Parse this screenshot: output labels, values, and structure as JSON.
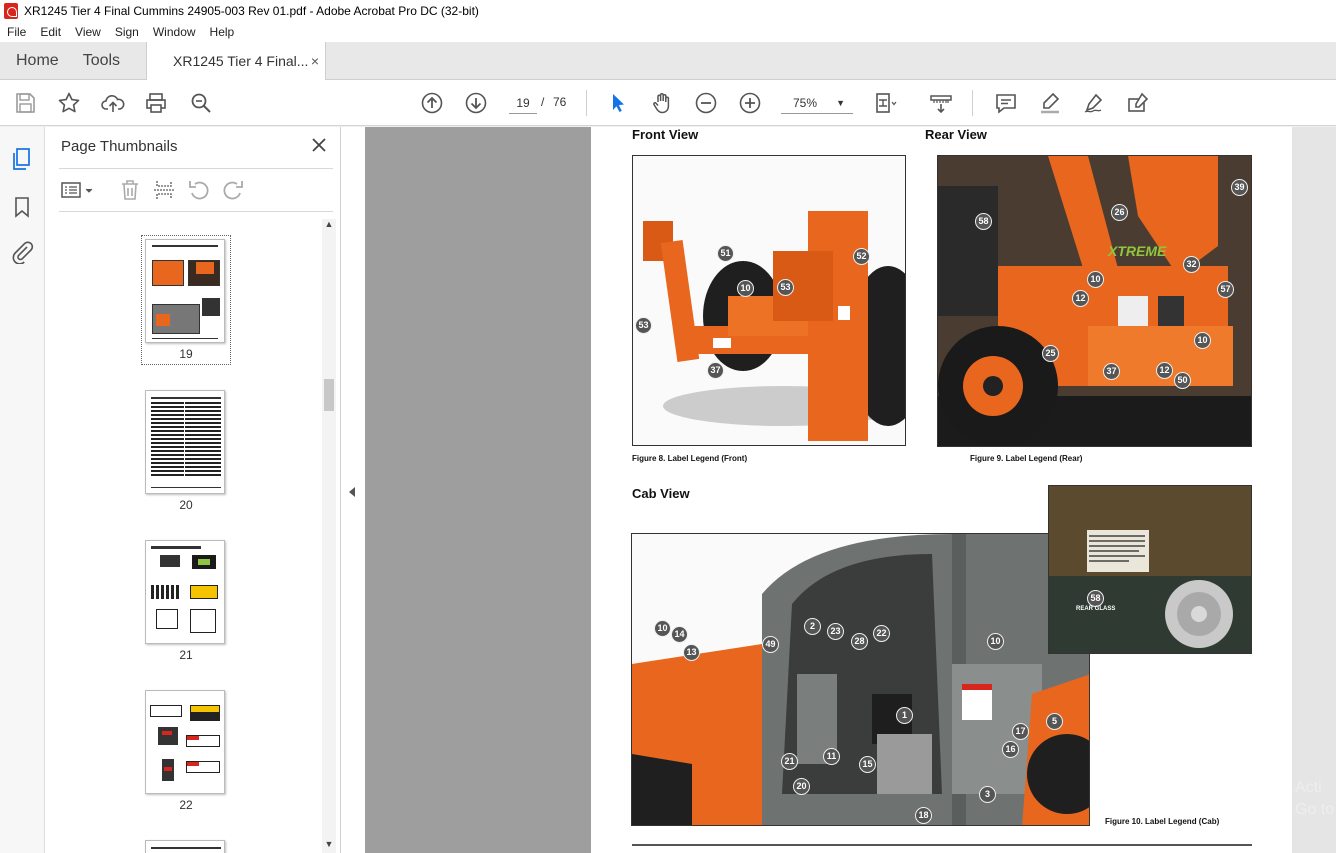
{
  "window": {
    "title": "XR1245 Tier 4 Final Cummins 24905-003 Rev 01.pdf - Adobe Acrobat Pro DC (32-bit)"
  },
  "menu": [
    "File",
    "Edit",
    "View",
    "Sign",
    "Window",
    "Help"
  ],
  "tabs": {
    "home": "Home",
    "tools": "Tools",
    "document": "XR1245 Tier 4 Final...",
    "close_symbol": "×"
  },
  "toolbar": {
    "current_page": "19",
    "page_separator": "/",
    "total_pages": "76",
    "zoom": "75%",
    "icons": [
      "save-icon",
      "bookmark-star-icon",
      "upload-icon",
      "print-icon",
      "zoom-search-icon",
      "page-up-icon",
      "page-down-icon",
      "select-cursor-icon",
      "hand-tool-icon",
      "zoom-out-icon",
      "zoom-in-icon",
      "page-fit-icon",
      "scroll-mode-icon",
      "comment-icon",
      "highlight-icon",
      "sign-icon",
      "fill-sign-icon"
    ]
  },
  "thumbnail_panel": {
    "title": "Page Thumbnails",
    "pages": [
      "19",
      "20",
      "21",
      "22"
    ]
  },
  "document": {
    "front_view_title": "Front View",
    "rear_view_title": "Rear View",
    "cab_view_title": "Cab View",
    "figure8_caption": "Figure 8. Label Legend (Front)",
    "figure9_caption": "Figure 9. Label Legend (Rear)",
    "figure10_caption": "Figure 10. Label Legend (Cab)",
    "rear_glass_label": "REAR GLASS",
    "front_callouts": [
      "51",
      "52",
      "10",
      "53",
      "53",
      "37"
    ],
    "rear_callouts": [
      "39",
      "26",
      "58",
      "32",
      "10",
      "57",
      "12",
      "10",
      "25",
      "37",
      "12",
      "50"
    ],
    "cab_callouts": [
      "10",
      "14",
      "13",
      "2",
      "23",
      "28",
      "22",
      "49",
      "10",
      "1",
      "5",
      "17",
      "16",
      "11",
      "15",
      "21",
      "20",
      "3",
      "18",
      "58"
    ],
    "watermark": "Acti\nGo to"
  },
  "colors": {
    "accent_blue": "#1473e6",
    "machine_orange": "#e8661e",
    "acrobat_red": "#d7261e"
  }
}
